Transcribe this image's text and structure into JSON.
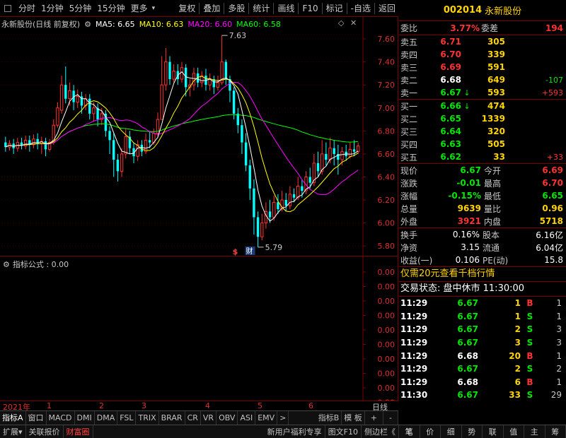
{
  "toolbar": {
    "items": [
      "分时",
      "1分钟",
      "5分钟",
      "15分钟",
      "更多",
      "复权",
      "叠加",
      "多股",
      "统计",
      "画线",
      "F10",
      "标记",
      "-自选",
      "返回"
    ]
  },
  "chart_header": {
    "title": "永新股份(日线 前复权)",
    "ma5": "MA5: 6.65",
    "ma10": "MA10: 6.63",
    "ma20": "MA20: 6.60",
    "ma60": "MA60: 6.58"
  },
  "colors": {
    "ma5": "#ffffff",
    "ma10": "#ffff00",
    "ma20": "#ff00ff",
    "ma60": "#00ff00",
    "up": "#ff3232",
    "down": "#00ffff",
    "grid": "#7a0000"
  },
  "chart_data": {
    "type": "candlestick",
    "ylim": [
      5.74,
      7.68
    ],
    "y_ticks": [
      "7.60",
      "7.40",
      "7.20",
      "7.00",
      "6.80",
      "6.60",
      "6.40",
      "6.20",
      "6.00",
      "5.80"
    ],
    "high_label": "7.63",
    "low_label": "5.79",
    "candles": [
      [
        6.7,
        6.66,
        6.75,
        6.62
      ],
      [
        6.66,
        6.69,
        6.72,
        6.63
      ],
      [
        6.69,
        6.65,
        6.73,
        6.6
      ],
      [
        6.65,
        6.7,
        6.74,
        6.62
      ],
      [
        6.7,
        6.67,
        6.74,
        6.64
      ],
      [
        6.67,
        6.72,
        6.76,
        6.64
      ],
      [
        6.72,
        6.68,
        6.76,
        6.62
      ],
      [
        6.68,
        6.73,
        6.77,
        6.65
      ],
      [
        6.73,
        6.69,
        6.78,
        6.64
      ],
      [
        6.69,
        6.71,
        6.75,
        6.6
      ],
      [
        6.71,
        6.64,
        6.74,
        6.58
      ],
      [
        6.64,
        6.7,
        6.73,
        6.62
      ],
      [
        6.7,
        6.85,
        6.9,
        6.68
      ],
      [
        6.85,
        7.0,
        7.05,
        6.83
      ],
      [
        6.98,
        7.2,
        7.28,
        6.95
      ],
      [
        7.2,
        7.08,
        7.36,
        7.04
      ],
      [
        7.08,
        7.15,
        7.22,
        7.02
      ],
      [
        7.15,
        7.05,
        7.2,
        6.98
      ],
      [
        7.05,
        7.1,
        7.16,
        7.0
      ],
      [
        7.1,
        7.02,
        7.14,
        6.95
      ],
      [
        7.02,
        7.08,
        7.12,
        6.98
      ],
      [
        7.08,
        6.95,
        7.12,
        6.9
      ],
      [
        6.95,
        7.0,
        7.05,
        6.88
      ],
      [
        7.0,
        6.9,
        7.04,
        6.84
      ],
      [
        6.9,
        6.95,
        7.0,
        6.85
      ],
      [
        6.95,
        6.8,
        6.98,
        6.75
      ],
      [
        6.8,
        6.72,
        6.84,
        6.6
      ],
      [
        6.72,
        6.55,
        6.78,
        6.4
      ],
      [
        6.55,
        6.45,
        6.6,
        6.36
      ],
      [
        6.45,
        6.6,
        6.65,
        6.4
      ],
      [
        6.6,
        6.75,
        6.82,
        6.56
      ],
      [
        6.75,
        6.65,
        6.8,
        6.6
      ],
      [
        6.65,
        6.58,
        6.7,
        6.52
      ],
      [
        6.58,
        6.68,
        6.72,
        6.54
      ],
      [
        6.68,
        6.62,
        6.72,
        6.58
      ],
      [
        6.62,
        6.72,
        6.78,
        6.6
      ],
      [
        6.72,
        6.7,
        6.8,
        6.65
      ],
      [
        6.7,
        6.78,
        6.82,
        6.68
      ],
      [
        6.78,
        6.9,
        6.96,
        6.75
      ],
      [
        6.9,
        7.2,
        7.45,
        6.9
      ],
      [
        7.2,
        7.4,
        7.52,
        7.15
      ],
      [
        7.4,
        7.25,
        7.45,
        7.2
      ],
      [
        7.25,
        7.32,
        7.38,
        7.22
      ],
      [
        7.32,
        7.25,
        7.38,
        7.2
      ],
      [
        7.25,
        7.35,
        7.4,
        7.22
      ],
      [
        7.35,
        7.18,
        7.38,
        7.1
      ],
      [
        7.18,
        7.2,
        7.25,
        7.1
      ],
      [
        7.2,
        7.3,
        7.35,
        7.15
      ],
      [
        7.3,
        7.22,
        7.35,
        7.18
      ],
      [
        7.22,
        7.28,
        7.32,
        7.18
      ],
      [
        7.28,
        7.2,
        7.34,
        7.15
      ],
      [
        7.2,
        7.25,
        7.3,
        7.15
      ],
      [
        7.25,
        7.18,
        7.28,
        7.12
      ],
      [
        7.18,
        7.22,
        7.28,
        7.15
      ],
      [
        7.22,
        7.4,
        7.63,
        7.2
      ],
      [
        7.4,
        7.25,
        7.42,
        7.2
      ],
      [
        7.25,
        7.15,
        7.28,
        7.05
      ],
      [
        7.15,
        6.95,
        7.18,
        6.9
      ],
      [
        6.95,
        6.85,
        7.0,
        6.78
      ],
      [
        6.85,
        6.7,
        6.9,
        6.6
      ],
      [
        6.7,
        6.5,
        6.78,
        6.45
      ],
      [
        6.5,
        6.3,
        6.55,
        6.2
      ],
      [
        6.3,
        6.05,
        6.38,
        5.9
      ],
      [
        6.05,
        5.88,
        6.1,
        5.79
      ],
      [
        5.88,
        6.0,
        6.08,
        5.85
      ],
      [
        6.0,
        6.1,
        6.18,
        5.95
      ],
      [
        6.1,
        6.05,
        6.2,
        6.0
      ],
      [
        6.05,
        6.18,
        6.24,
        6.02
      ],
      [
        6.18,
        6.12,
        6.25,
        6.08
      ],
      [
        6.12,
        6.2,
        6.28,
        6.1
      ],
      [
        6.2,
        6.15,
        6.26,
        6.1
      ],
      [
        6.15,
        6.25,
        6.32,
        6.12
      ],
      [
        6.25,
        6.22,
        6.3,
        6.18
      ],
      [
        6.22,
        6.32,
        6.4,
        6.2
      ],
      [
        6.32,
        6.28,
        6.38,
        6.22
      ],
      [
        6.28,
        6.4,
        6.45,
        6.25
      ],
      [
        6.4,
        6.35,
        6.48,
        6.3
      ],
      [
        6.35,
        6.52,
        6.6,
        6.32
      ],
      [
        6.52,
        6.45,
        6.62,
        6.4
      ],
      [
        6.45,
        6.6,
        6.72,
        6.42
      ],
      [
        6.6,
        6.55,
        6.7,
        6.5
      ],
      [
        6.55,
        6.65,
        6.74,
        6.52
      ],
      [
        6.65,
        6.6,
        6.72,
        6.5
      ],
      [
        6.6,
        6.55,
        6.68,
        6.42
      ],
      [
        6.55,
        6.62,
        6.66,
        6.5
      ],
      [
        6.62,
        6.58,
        6.68,
        6.54
      ],
      [
        6.58,
        6.64,
        6.7,
        6.56
      ],
      [
        6.64,
        6.62,
        6.72,
        6.58
      ],
      [
        6.62,
        6.67,
        6.7,
        6.6
      ]
    ],
    "marker_dollar": "$",
    "marker_cai": "财"
  },
  "indicator": {
    "title": "指标公式 : 0.00",
    "y_ticks": [
      "0.00",
      "0.00",
      "0.00",
      "0.00",
      "0.00",
      "0.00",
      "0.00",
      "0.00",
      "0.00",
      "0.00"
    ]
  },
  "date_strip": {
    "year": "2021年",
    "months": [
      "1",
      "2",
      "3",
      "4",
      "5",
      "6"
    ],
    "mode": "日线"
  },
  "ind_tabs": [
    "指标A",
    "窗口",
    "MACD",
    "DMI",
    "DMA",
    "FSL",
    "TRIX",
    "BRAR",
    "CR",
    "VR",
    "OBV",
    "ASI",
    "EMV",
    ">",
    "指标B",
    "模 板",
    "+",
    "-"
  ],
  "bottom_bar": {
    "left": [
      "扩展",
      "关联报价",
      "财富圈"
    ],
    "right": [
      "新用户福利专享",
      "图文F10",
      "侧边栏《"
    ]
  },
  "stock": {
    "code": "002014",
    "name": "永新股份"
  },
  "order_book": {
    "wei_bi_label": "委比",
    "wei_bi": "3.77%",
    "wei_cha_label": "委差",
    "wei_cha": "194",
    "sells": [
      {
        "label": "卖五",
        "price": "6.71",
        "vol": "305",
        "chg": ""
      },
      {
        "label": "卖四",
        "price": "6.70",
        "vol": "339",
        "chg": ""
      },
      {
        "label": "卖三",
        "price": "6.69",
        "vol": "591",
        "chg": ""
      },
      {
        "label": "卖二",
        "price": "6.68",
        "vol": "649",
        "chg": "-107"
      },
      {
        "label": "卖一",
        "price": "6.67",
        "vol": "593",
        "chg": "+593",
        "arrow": "↓"
      }
    ],
    "buys": [
      {
        "label": "买一",
        "price": "6.66",
        "vol": "474",
        "chg": "",
        "arrow": "↓"
      },
      {
        "label": "买二",
        "price": "6.65",
        "vol": "1339",
        "chg": ""
      },
      {
        "label": "买三",
        "price": "6.64",
        "vol": "320",
        "chg": ""
      },
      {
        "label": "买四",
        "price": "6.63",
        "vol": "505",
        "chg": ""
      },
      {
        "label": "买五",
        "price": "6.62",
        "vol": "33",
        "chg": "+33"
      }
    ]
  },
  "quote": [
    {
      "l1": "现价",
      "v1": "6.67",
      "c1": "green",
      "l2": "今开",
      "v2": "6.69",
      "c2": "red"
    },
    {
      "l1": "涨跌",
      "v1": "-0.01",
      "c1": "green",
      "l2": "最高",
      "v2": "6.70",
      "c2": "red"
    },
    {
      "l1": "涨幅",
      "v1": "-0.15%",
      "c1": "green",
      "l2": "最低",
      "v2": "6.65",
      "c2": "green"
    },
    {
      "l1": "总量",
      "v1": "9639",
      "c1": "yellow",
      "l2": "量比",
      "v2": "0.96",
      "c2": "yellow"
    },
    {
      "l1": "外盘",
      "v1": "3921",
      "c1": "red",
      "l2": "内盘",
      "v2": "5718",
      "c2": "yellow"
    }
  ],
  "stats": [
    {
      "l1": "换手",
      "v1": "0.16%",
      "l2": "股本",
      "v2": "6.16亿"
    },
    {
      "l1": "净资",
      "v1": "3.15",
      "l2": "流通",
      "v2": "6.04亿"
    },
    {
      "l1": "收益(一)",
      "v1": "0.106",
      "l2": "PE(动)",
      "v2": "15.8"
    }
  ],
  "promo": "仅需20元查看千档行情",
  "status": "交易状态: 盘中休市 11:30:00",
  "ticks": [
    {
      "time": "11:29",
      "price": "6.67",
      "pc": "green",
      "vol": "1",
      "vc": "yellow",
      "bs": "B",
      "bc": "red",
      "n": "1"
    },
    {
      "time": "11:29",
      "price": "6.67",
      "pc": "green",
      "vol": "1",
      "vc": "yellow",
      "bs": "S",
      "bc": "green",
      "n": "1"
    },
    {
      "time": "11:29",
      "price": "6.67",
      "pc": "green",
      "vol": "2",
      "vc": "yellow",
      "bs": "S",
      "bc": "green",
      "n": "3"
    },
    {
      "time": "11:29",
      "price": "6.67",
      "pc": "green",
      "vol": "3",
      "vc": "yellow",
      "bs": "S",
      "bc": "green",
      "n": "3"
    },
    {
      "time": "11:29",
      "price": "6.68",
      "pc": "white",
      "vol": "20",
      "vc": "yellow",
      "bs": "B",
      "bc": "red",
      "n": "1"
    },
    {
      "time": "11:29",
      "price": "6.67",
      "pc": "green",
      "vol": "2",
      "vc": "yellow",
      "bs": "S",
      "bc": "green",
      "n": "2"
    },
    {
      "time": "11:29",
      "price": "6.68",
      "pc": "white",
      "vol": "6",
      "vc": "yellow",
      "bs": "B",
      "bc": "red",
      "n": "1"
    },
    {
      "time": "11:30",
      "price": "6.67",
      "pc": "green",
      "vol": "33",
      "vc": "yellow",
      "bs": "S",
      "bc": "green",
      "n": "29"
    }
  ],
  "right_tabs": [
    "笔",
    "价",
    "细",
    "势",
    "联",
    "值",
    "主",
    "筹"
  ]
}
